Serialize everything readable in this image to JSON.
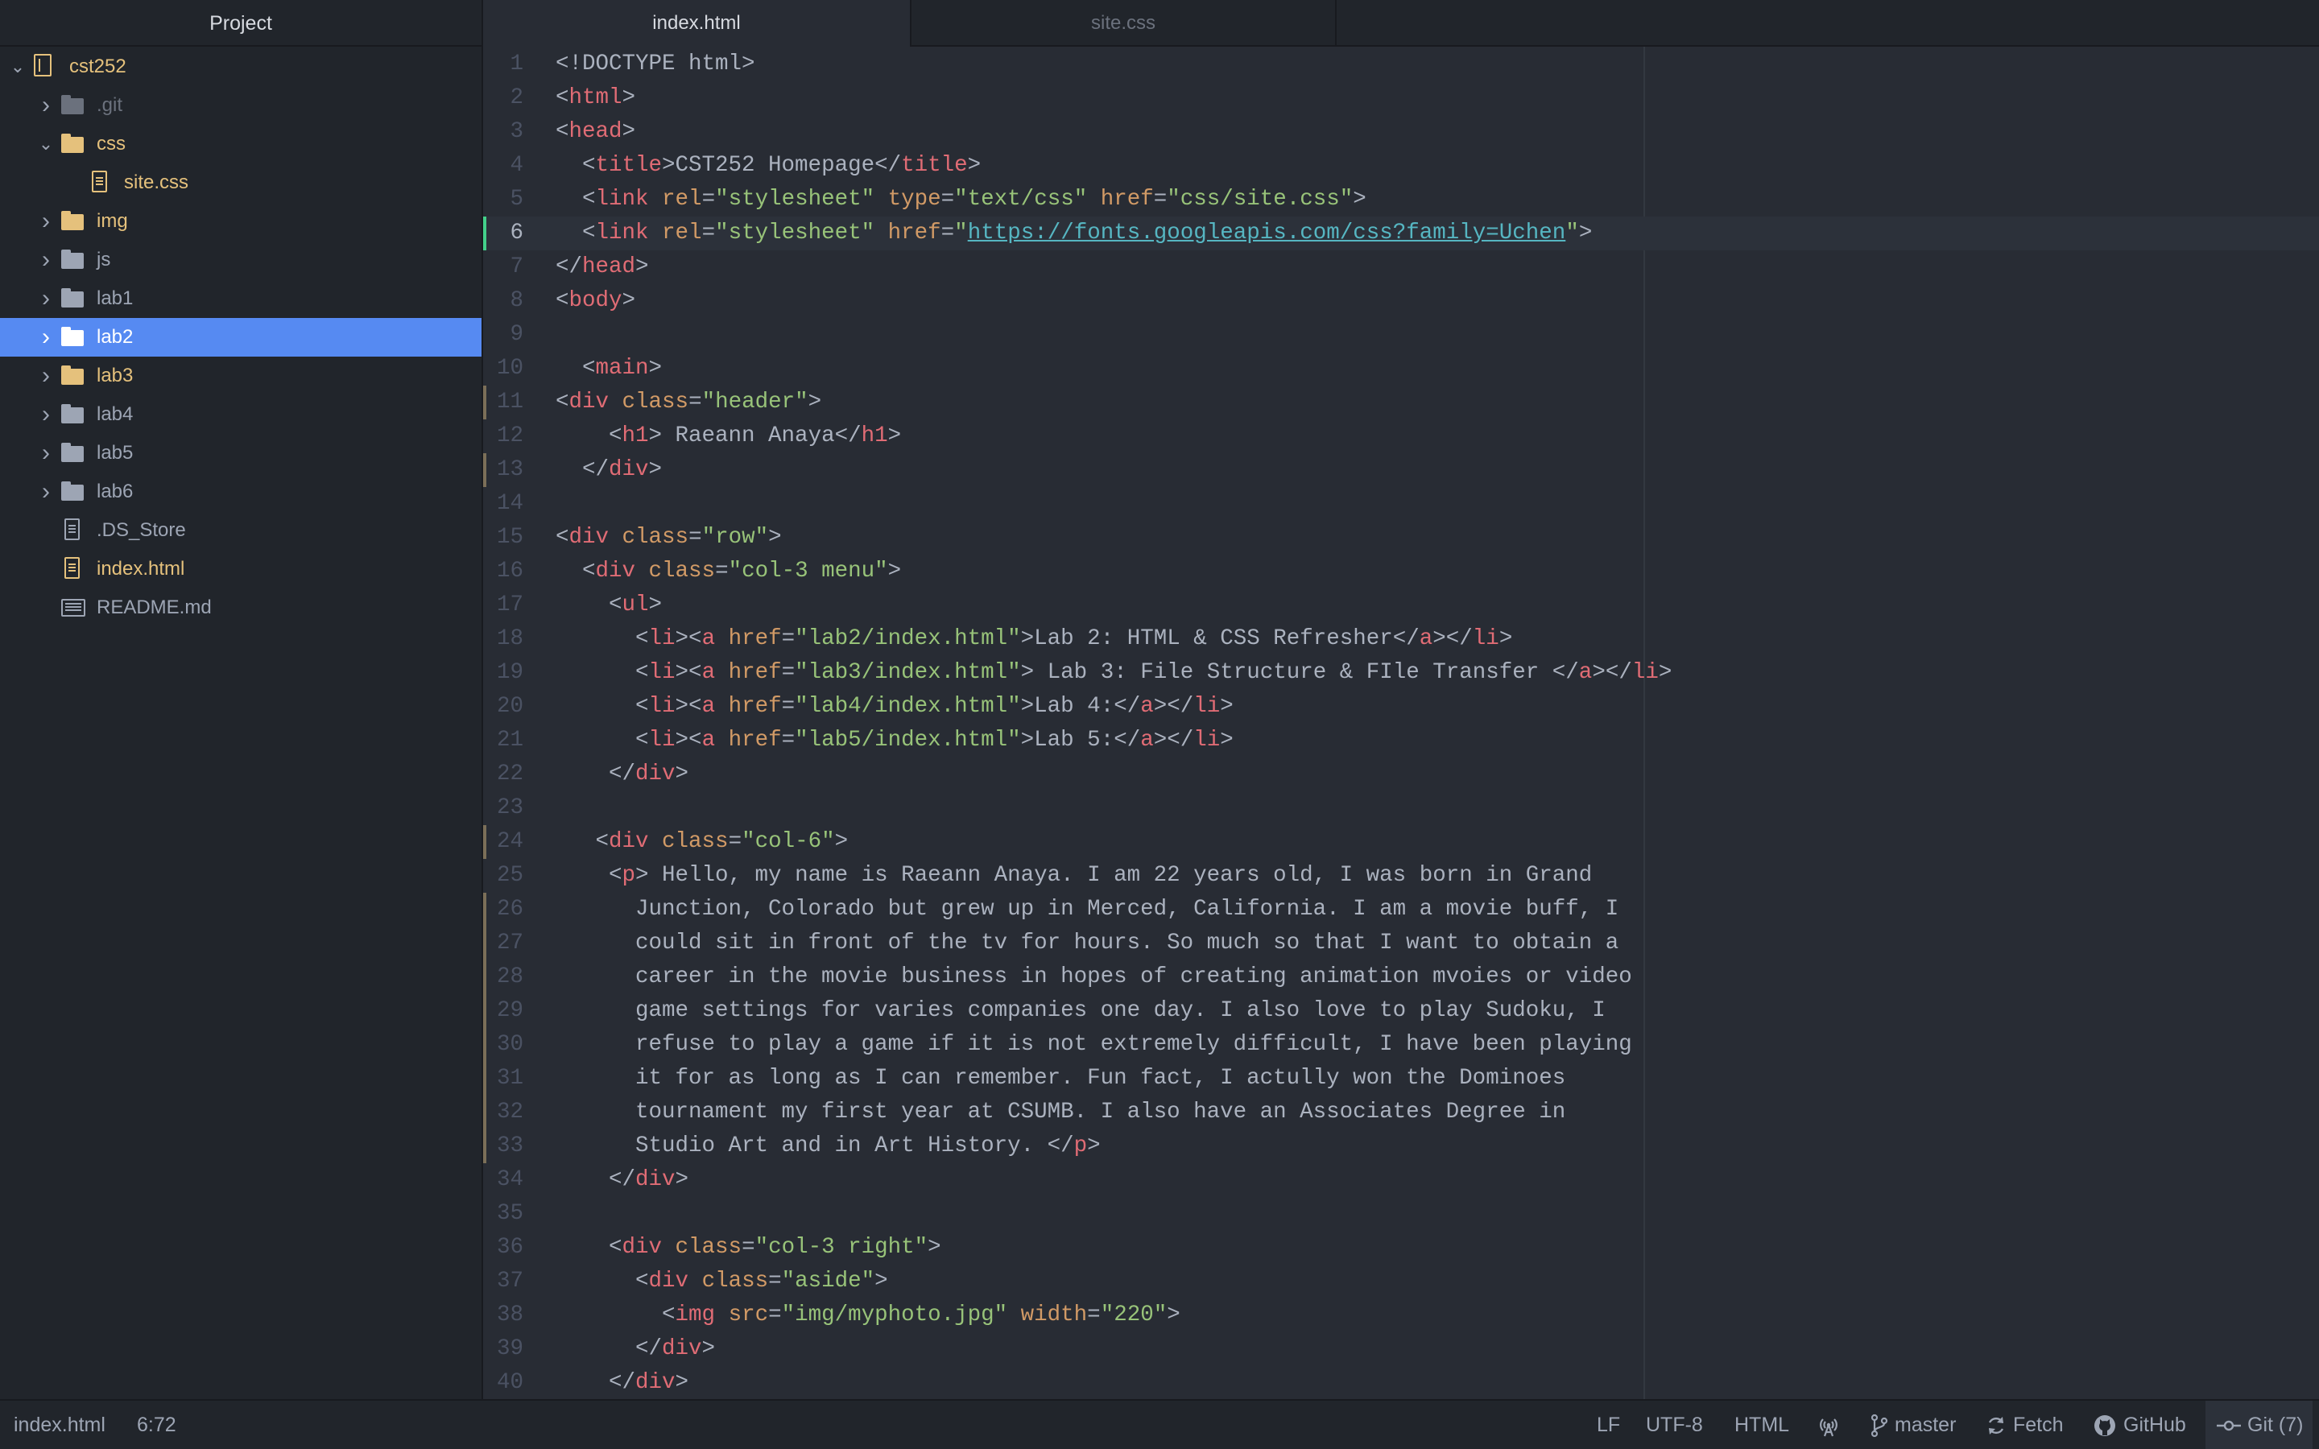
{
  "sidebar": {
    "title": "Project",
    "root": "cst252",
    "items": [
      {
        "label": ".git",
        "kind": "folder",
        "icon": "folder-icon",
        "expanded": false,
        "state": "ignored"
      },
      {
        "label": "css",
        "kind": "folder",
        "icon": "folder-icon",
        "expanded": true,
        "state": "modified"
      },
      {
        "label": "site.css",
        "kind": "file",
        "icon": "file-icon",
        "state": "modified"
      },
      {
        "label": "img",
        "kind": "folder",
        "icon": "folder-icon",
        "expanded": false,
        "state": "modified"
      },
      {
        "label": "js",
        "kind": "folder",
        "icon": "folder-icon",
        "expanded": false,
        "state": "normal"
      },
      {
        "label": "lab1",
        "kind": "folder",
        "icon": "folder-icon",
        "expanded": false,
        "state": "normal"
      },
      {
        "label": "lab2",
        "kind": "folder",
        "icon": "folder-icon",
        "expanded": false,
        "state": "selected"
      },
      {
        "label": "lab3",
        "kind": "folder",
        "icon": "folder-icon",
        "expanded": false,
        "state": "modified"
      },
      {
        "label": "lab4",
        "kind": "folder",
        "icon": "folder-icon",
        "expanded": false,
        "state": "normal"
      },
      {
        "label": "lab5",
        "kind": "folder",
        "icon": "folder-icon",
        "expanded": false,
        "state": "normal"
      },
      {
        "label": "lab6",
        "kind": "folder",
        "icon": "folder-icon",
        "expanded": false,
        "state": "normal"
      },
      {
        "label": ".DS_Store",
        "kind": "file",
        "icon": "file-icon",
        "state": "normal"
      },
      {
        "label": "index.html",
        "kind": "file",
        "icon": "file-icon",
        "state": "modified"
      },
      {
        "label": "README.md",
        "kind": "file",
        "icon": "readme-icon",
        "state": "normal"
      }
    ]
  },
  "tabs": [
    {
      "label": "index.html",
      "active": true
    },
    {
      "label": "site.css",
      "active": false
    }
  ],
  "editor": {
    "cursor_line": 6,
    "lines": [
      {
        "n": "1",
        "mark": "",
        "html": "&lt;!DOCTYPE html&gt;"
      },
      {
        "n": "2",
        "mark": "",
        "html": "&lt;<span class=\"tag\">html</span>&gt;"
      },
      {
        "n": "3",
        "mark": "",
        "html": "&lt;<span class=\"tag\">head</span>&gt;"
      },
      {
        "n": "4",
        "mark": "",
        "html": "  &lt;<span class=\"tag\">title</span>&gt;CST252 Homepage&lt;/<span class=\"tag\">title</span>&gt;"
      },
      {
        "n": "5",
        "mark": "",
        "html": "  &lt;<span class=\"tag\">link</span> <span class=\"attr\">rel</span>=<span class=\"str\">\"stylesheet\"</span> <span class=\"attr\">type</span>=<span class=\"str\">\"text/css\"</span> <span class=\"attr\">href</span>=<span class=\"str\">\"css/site.css\"</span>&gt;"
      },
      {
        "n": "6",
        "mark": "added",
        "html": "  &lt;<span class=\"tag\">link</span> <span class=\"attr\">rel</span>=<span class=\"str\">\"stylesheet\"</span> <span class=\"attr\">href</span>=<span class=\"str\">\"</span><span class=\"url\">https://fonts.googleapis.com/css?family=Uchen</span><span class=\"str\">\"</span>&gt;"
      },
      {
        "n": "7",
        "mark": "",
        "html": "&lt;/<span class=\"tag\">head</span>&gt;"
      },
      {
        "n": "8",
        "mark": "",
        "html": "&lt;<span class=\"tag\">body</span>&gt;"
      },
      {
        "n": "9",
        "mark": "",
        "html": ""
      },
      {
        "n": "10",
        "mark": "",
        "html": "  &lt;<span class=\"tag\">main</span>&gt;"
      },
      {
        "n": "11",
        "mark": "modified",
        "html": "&lt;<span class=\"tag\">div</span> <span class=\"attr\">class</span>=<span class=\"str\">\"header\"</span>&gt;"
      },
      {
        "n": "12",
        "mark": "",
        "html": "    &lt;<span class=\"tag\">h1</span>&gt; Raeann Anaya&lt;/<span class=\"tag\">h1</span>&gt;"
      },
      {
        "n": "13",
        "mark": "modified",
        "html": "  &lt;/<span class=\"tag\">div</span>&gt;"
      },
      {
        "n": "14",
        "mark": "",
        "html": ""
      },
      {
        "n": "15",
        "mark": "",
        "html": "&lt;<span class=\"tag\">div</span> <span class=\"attr\">class</span>=<span class=\"str\">\"row\"</span>&gt;"
      },
      {
        "n": "16",
        "mark": "",
        "html": "  &lt;<span class=\"tag\">div</span> <span class=\"attr\">class</span>=<span class=\"str\">\"col-3 menu\"</span>&gt;"
      },
      {
        "n": "17",
        "mark": "",
        "html": "    &lt;<span class=\"tag\">ul</span>&gt;"
      },
      {
        "n": "18",
        "mark": "",
        "html": "      &lt;<span class=\"tag\">li</span>&gt;&lt;<span class=\"tag\">a</span> <span class=\"attr\">href</span>=<span class=\"str\">\"lab2/index.html\"</span>&gt;Lab 2: HTML &amp; CSS Refresher&lt;/<span class=\"tag\">a</span>&gt;&lt;/<span class=\"tag\">li</span>&gt;"
      },
      {
        "n": "19",
        "mark": "",
        "html": "      &lt;<span class=\"tag\">li</span>&gt;&lt;<span class=\"tag\">a</span> <span class=\"attr\">href</span>=<span class=\"str\">\"lab3/index.html\"</span>&gt; Lab 3: File Structure &amp; FIle Transfer &lt;/<span class=\"tag\">a</span>&gt;&lt;/<span class=\"tag\">li</span>&gt;"
      },
      {
        "n": "20",
        "mark": "",
        "html": "      &lt;<span class=\"tag\">li</span>&gt;&lt;<span class=\"tag\">a</span> <span class=\"attr\">href</span>=<span class=\"str\">\"lab4/index.html\"</span>&gt;Lab 4:&lt;/<span class=\"tag\">a</span>&gt;&lt;/<span class=\"tag\">li</span>&gt;"
      },
      {
        "n": "21",
        "mark": "",
        "html": "      &lt;<span class=\"tag\">li</span>&gt;&lt;<span class=\"tag\">a</span> <span class=\"attr\">href</span>=<span class=\"str\">\"lab5/index.html\"</span>&gt;Lab 5:&lt;/<span class=\"tag\">a</span>&gt;&lt;/<span class=\"tag\">li</span>&gt;"
      },
      {
        "n": "22",
        "mark": "",
        "html": "    &lt;/<span class=\"tag\">div</span>&gt;"
      },
      {
        "n": "23",
        "mark": "",
        "html": ""
      },
      {
        "n": "24",
        "mark": "modified",
        "html": "   &lt;<span class=\"tag\">div</span> <span class=\"attr\">class</span>=<span class=\"str\">\"col-6\"</span>&gt;"
      },
      {
        "n": "25",
        "mark": "",
        "html": "    &lt;<span class=\"tag\">p</span>&gt; Hello, my name is Raeann Anaya. I am 22 years old, I was born in Grand"
      },
      {
        "n": "26",
        "mark": "modified",
        "html": "      Junction, Colorado but grew up in Merced, California. I am a movie buff, I"
      },
      {
        "n": "27",
        "mark": "modified",
        "html": "      could sit in front of the tv for hours. So much so that I want to obtain a"
      },
      {
        "n": "28",
        "mark": "modified",
        "html": "      career in the movie business in hopes of creating animation mvoies or video"
      },
      {
        "n": "29",
        "mark": "modified",
        "html": "      game settings for varies companies one day. I also love to play Sudoku, I"
      },
      {
        "n": "30",
        "mark": "modified",
        "html": "      refuse to play a game if it is not extremely difficult, I have been playing"
      },
      {
        "n": "31",
        "mark": "modified",
        "html": "      it for as long as I can remember. Fun fact, I actully won the Dominoes"
      },
      {
        "n": "32",
        "mark": "modified",
        "html": "      tournament my first year at CSUMB. I also have an Associates Degree in"
      },
      {
        "n": "33",
        "mark": "modified",
        "html": "      Studio Art and in Art History. &lt;/<span class=\"tag\">p</span>&gt;"
      },
      {
        "n": "34",
        "mark": "",
        "html": "    &lt;/<span class=\"tag\">div</span>&gt;"
      },
      {
        "n": "35",
        "mark": "",
        "html": ""
      },
      {
        "n": "36",
        "mark": "",
        "html": "    &lt;<span class=\"tag\">div</span> <span class=\"attr\">class</span>=<span class=\"str\">\"col-3 right\"</span>&gt;"
      },
      {
        "n": "37",
        "mark": "",
        "html": "      &lt;<span class=\"tag\">div</span> <span class=\"attr\">class</span>=<span class=\"str\">\"aside\"</span>&gt;"
      },
      {
        "n": "38",
        "mark": "",
        "html": "        &lt;<span class=\"tag\">img</span> <span class=\"attr\">src</span>=<span class=\"str\">\"img/myphoto.jpg\"</span> <span class=\"attr\">width</span>=<span class=\"str\">\"220\"</span>&gt;"
      },
      {
        "n": "39",
        "mark": "",
        "html": "      &lt;/<span class=\"tag\">div</span>&gt;"
      },
      {
        "n": "40",
        "mark": "",
        "html": "    &lt;/<span class=\"tag\">div</span>&gt;"
      }
    ]
  },
  "statusbar": {
    "file": "index.html",
    "cursor_pos": "6:72",
    "line_ending": "LF",
    "encoding": "UTF-8",
    "grammar": "HTML",
    "branch": "master",
    "fetch": "Fetch",
    "github": "GitHub",
    "git": "Git (7)"
  },
  "colors": {
    "selection": "#568af2",
    "modified": "#e5c17c",
    "added_marker": "#43d08a",
    "tag": "#e06c75",
    "attribute": "#d19a66",
    "string": "#98c379",
    "url": "#56b6c2"
  }
}
